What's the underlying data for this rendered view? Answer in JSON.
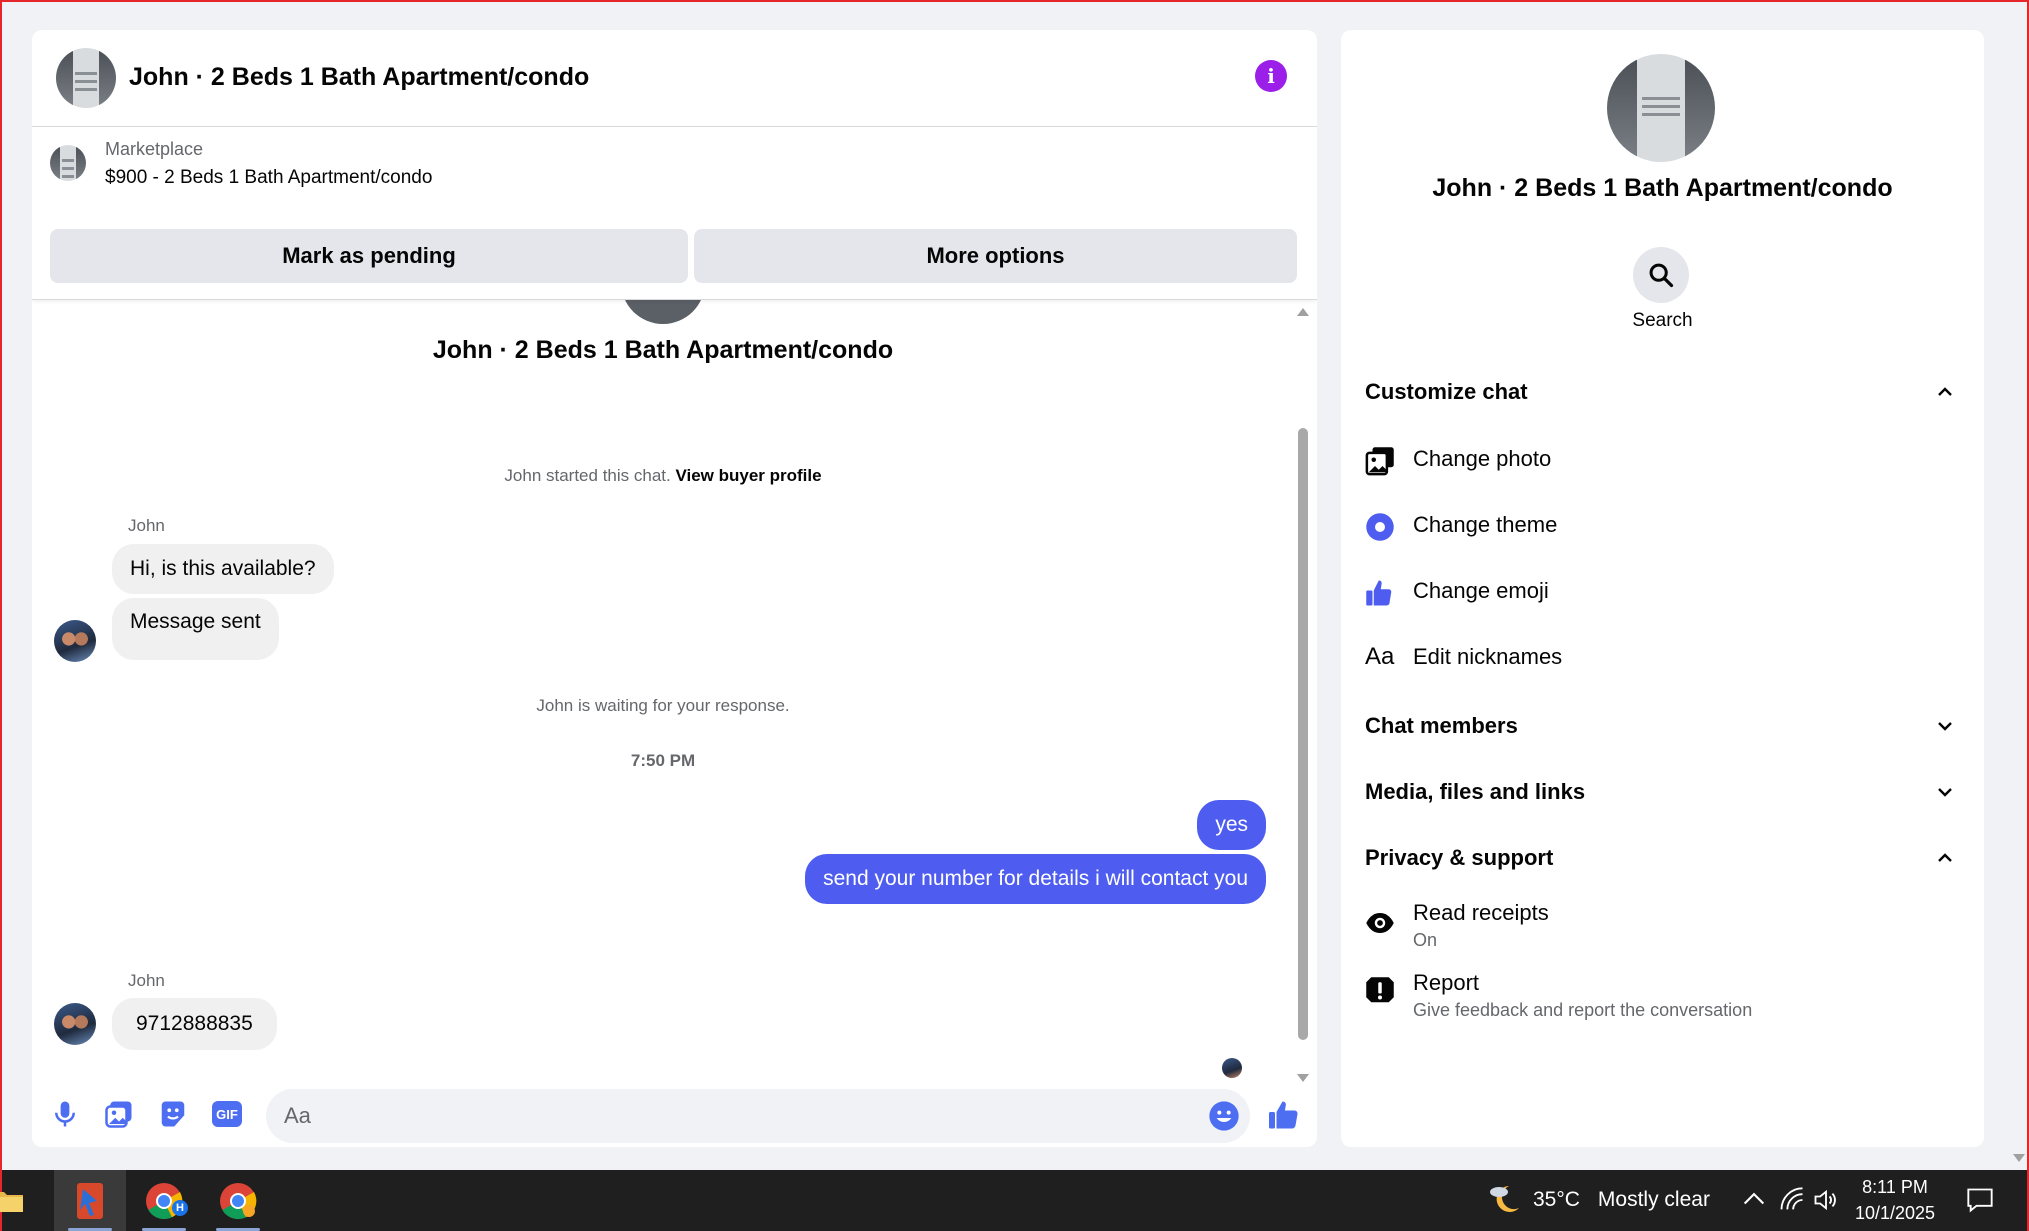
{
  "header": {
    "title": "John · 2 Beds 1 Bath Apartment/condo",
    "info_icon": "info-icon"
  },
  "listing": {
    "source": "Marketplace",
    "name": "$900 - 2 Beds 1 Bath Apartment/condo",
    "mark_pending_label": "Mark as pending",
    "more_options_label": "More options"
  },
  "conversation": {
    "intro_title": "John · 2 Beds 1 Bath Apartment/condo",
    "started_text": "John started this chat.",
    "view_buyer_profile": "View buyer profile",
    "waiting_text": "John is waiting for your response.",
    "timestamp": "7:50 PM",
    "messages": [
      {
        "sender": "John",
        "direction": "in",
        "text": "Hi, is this available?"
      },
      {
        "sender": "John",
        "direction": "in",
        "text": "Message sent"
      },
      {
        "sender": "me",
        "direction": "out",
        "text": "yes"
      },
      {
        "sender": "me",
        "direction": "out",
        "text": "send your number for details i will contact you"
      },
      {
        "sender": "John",
        "direction": "in",
        "text": "9712888835"
      }
    ],
    "sender_name_1": "John",
    "sender_name_2": "John"
  },
  "composer": {
    "placeholder": "Aa",
    "icons": [
      "microphone-icon",
      "photo-icon",
      "sticker-icon",
      "gif-icon",
      "emoji-icon",
      "thumbs-up-icon"
    ],
    "gif_text": "GIF"
  },
  "info_panel": {
    "title": "John · 2 Beds 1 Bath Apartment/condo",
    "search_label": "Search",
    "sections": {
      "customize_chat": "Customize chat",
      "chat_members": "Chat members",
      "media": "Media, files and links",
      "privacy": "Privacy & support"
    },
    "customize_options": [
      {
        "label": "Change photo",
        "icon": "photo-icon"
      },
      {
        "label": "Change theme",
        "icon": "theme-circle-icon"
      },
      {
        "label": "Change emoji",
        "icon": "thumbs-up-icon"
      },
      {
        "label": "Edit nicknames",
        "icon": "text-aa-icon"
      }
    ],
    "nicknames_icon_text": "Aa",
    "privacy_options": [
      {
        "label": "Read receipts",
        "sub": "On",
        "icon": "eye-icon"
      },
      {
        "label": "Report",
        "sub": "Give feedback and report the conversation",
        "icon": "report-icon"
      }
    ]
  },
  "taskbar": {
    "weather_temp": "35°C",
    "weather_desc": "Mostly clear",
    "time": "8:11 PM",
    "date": "10/1/2025",
    "chrome_profile_letter": "H"
  },
  "colors": {
    "accent": "#4e5df0",
    "info_purple": "#9b1fe8",
    "bubble_in": "#f0f0f0",
    "text_secondary": "#65676b"
  }
}
